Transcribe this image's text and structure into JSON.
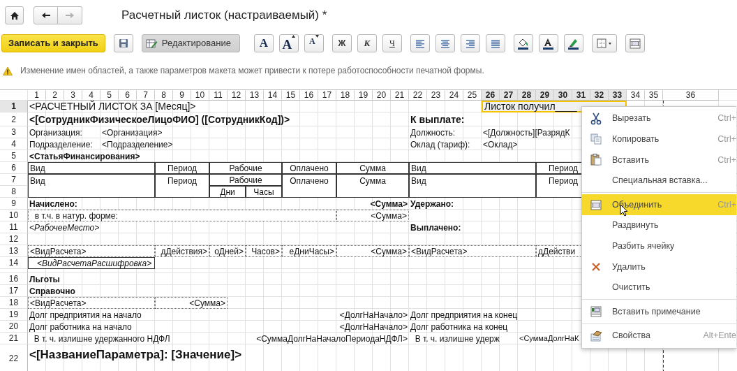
{
  "window": {
    "title": "Расчетный листок (настраиваемый) *",
    "nav": [
      {
        "kind": "home",
        "disabled": false
      },
      {
        "kind": "back",
        "disabled": false
      },
      {
        "kind": "forward",
        "disabled": true
      }
    ]
  },
  "toolbar": [
    {
      "kind": "primary",
      "label": "Записать и закрыть"
    },
    {
      "kind": "save"
    },
    {
      "kind": "toggle",
      "label": "Редактирование",
      "on": true
    },
    {
      "kind": "font",
      "label": "A"
    },
    {
      "kind": "grow",
      "label": "A"
    },
    {
      "kind": "shrink",
      "label": "A"
    },
    {
      "kind": "bold",
      "label": "Ж"
    },
    {
      "kind": "italic",
      "label": "К"
    },
    {
      "kind": "underline",
      "label": "Ч"
    },
    {
      "kind": "align-left"
    },
    {
      "kind": "align-center"
    },
    {
      "kind": "align-right"
    },
    {
      "kind": "justify"
    },
    {
      "kind": "fill-color"
    },
    {
      "kind": "text-color"
    },
    {
      "kind": "highlight"
    },
    {
      "kind": "borders"
    },
    {
      "kind": "cell"
    }
  ],
  "warning": "Изменение имен областей, а также параметров макета может привести к потере работоспособности печатной формы.",
  "sheet": {
    "column_numbers": [
      {
        "label": "1",
        "selected": false
      },
      {
        "label": "2",
        "selected": false
      },
      {
        "label": "3",
        "selected": false
      },
      {
        "label": "4",
        "selected": false
      },
      {
        "label": "5",
        "selected": false
      },
      {
        "label": "6",
        "selected": false
      },
      {
        "label": "7",
        "selected": false
      },
      {
        "label": "8",
        "selected": false
      },
      {
        "label": "9",
        "selected": false
      },
      {
        "label": "10",
        "selected": false
      },
      {
        "label": "11",
        "selected": false
      },
      {
        "label": "12",
        "selected": false
      },
      {
        "label": "13",
        "selected": false
      },
      {
        "label": "14",
        "selected": false
      },
      {
        "label": "15",
        "selected": false
      },
      {
        "label": "16",
        "selected": false
      },
      {
        "label": "17",
        "selected": false
      },
      {
        "label": "18",
        "selected": false
      },
      {
        "label": "19",
        "selected": false
      },
      {
        "label": "20",
        "selected": false
      },
      {
        "label": "21",
        "selected": false
      },
      {
        "label": "22",
        "selected": false
      },
      {
        "label": "23",
        "selected": false
      },
      {
        "label": "24",
        "selected": false
      },
      {
        "label": "25",
        "selected": false
      },
      {
        "label": "26",
        "selected": true
      },
      {
        "label": "27",
        "selected": true
      },
      {
        "label": "28",
        "selected": true
      },
      {
        "label": "29",
        "selected": true
      },
      {
        "label": "30",
        "selected": true
      },
      {
        "label": "31",
        "selected": true
      },
      {
        "label": "32",
        "selected": true
      },
      {
        "label": "33",
        "selected": true
      },
      {
        "label": "34",
        "selected": false
      },
      {
        "label": "35",
        "selected": false
      },
      {
        "label": "36",
        "selected": false
      }
    ],
    "lines": [
      {
        "number": "1",
        "kind": "title",
        "selected": true,
        "fields": [
          {
            "text": "<РАСЧЕТНЫЙ ЛИСТОК ЗА [Месяц]>"
          },
          {
            "text": "Листок получил____",
            "selected": true
          }
        ]
      },
      {
        "number": "2",
        "kind": "heading",
        "selected": false,
        "fields": [
          {
            "text": "<[СотрудникФизическоеЛицоФИО] ([СотрудникКод])>",
            "bold": true
          },
          {
            "text": "К выплате:",
            "bold": true
          }
        ]
      },
      {
        "number": "3",
        "kind": "normal",
        "selected": false,
        "fields": [
          {
            "text": "Организация:"
          },
          {
            "text": "<Организация>"
          },
          {
            "text": "Должность:"
          },
          {
            "text": "<[Должность][РазрядК"
          }
        ]
      },
      {
        "number": "4",
        "kind": "normal",
        "selected": false,
        "fields": [
          {
            "text": "Подразделение:"
          },
          {
            "text": "<Подразделение>"
          },
          {
            "text": "Оклад (тариф):"
          },
          {
            "text": "<Оклад>"
          }
        ]
      },
      {
        "number": "5",
        "kind": "normal",
        "selected": false,
        "fields": [
          {
            "text": "<СтатьяФинансирования>",
            "bold": true
          }
        ]
      },
      {
        "number": "6",
        "kind": "normal",
        "selected": false,
        "fields": [
          {
            "text": "Вид"
          },
          {
            "text": "Период"
          },
          {
            "text": "Рабочие"
          },
          {
            "text": "Оплачено"
          },
          {
            "text": "Сумма"
          },
          {
            "text": "Вид"
          },
          {
            "text": "Период"
          }
        ]
      },
      {
        "number": "7",
        "kind": "normal",
        "selected": false,
        "fields": [
          {
            "text": "Вид"
          },
          {
            "text": "Период"
          },
          {
            "text": "Рабочие"
          },
          {
            "text": "Оплачено"
          },
          {
            "text": "Сумма"
          },
          {
            "text": "Вид"
          },
          {
            "text": "Период"
          }
        ]
      },
      {
        "number": "8",
        "kind": "normal",
        "selected": false,
        "fields": [
          {
            "text": "Дни"
          },
          {
            "text": "Часы"
          }
        ]
      },
      {
        "number": "9",
        "kind": "normal",
        "selected": false,
        "fields": [
          {
            "text": "Начислено:",
            "bold": true
          },
          {
            "text": "<Сумма>",
            "bold": true
          },
          {
            "text": "Удержано:",
            "bold": true
          }
        ]
      },
      {
        "number": "10",
        "kind": "normal",
        "selected": false,
        "fields": [
          {
            "text": "  в т.ч. в натур. форме:"
          },
          {
            "text": "<Сумма>"
          }
        ]
      },
      {
        "number": "11",
        "kind": "normal",
        "selected": false,
        "fields": [
          {
            "text": "<РабочееМесто>",
            "italic": true
          },
          {
            "text": "Выплачено:",
            "bold": true
          }
        ]
      },
      {
        "number": "12",
        "kind": "normal",
        "selected": false
      },
      {
        "number": "13",
        "kind": "normal",
        "selected": false,
        "fields": [
          {
            "text": "<ВидРасчета>"
          },
          {
            "text": "дДействия>"
          },
          {
            "text": "оДней>"
          },
          {
            "text": "Часов>"
          },
          {
            "text": "еДниЧасы>"
          },
          {
            "text": "<Сумма>"
          },
          {
            "text": "<ВидРасчета>"
          },
          {
            "text": "дДействи"
          }
        ]
      },
      {
        "number": "14",
        "kind": "normal",
        "selected": false,
        "fields": [
          {
            "text": "   <ВидРасчетаРасшифровка>",
            "italic": true
          }
        ]
      },
      {
        "kind": "spacer",
        "selected": false
      },
      {
        "number": "16",
        "kind": "normal",
        "selected": false,
        "fields": [
          {
            "text": "Льготы",
            "bold": true
          }
        ]
      },
      {
        "number": "17",
        "kind": "normal",
        "selected": false,
        "fields": [
          {
            "text": "Справочно",
            "bold": true
          }
        ]
      },
      {
        "number": "18",
        "kind": "normal",
        "selected": false,
        "fields": [
          {
            "text": "<ВидРасчета>"
          },
          {
            "text": "<Сумма>"
          }
        ]
      },
      {
        "number": "19",
        "kind": "normal",
        "selected": false,
        "fields": [
          {
            "text": "Долг предприятия на начало"
          },
          {
            "text": "<ДолгНаНачало>"
          },
          {
            "text": "Долг предприятия на конец"
          }
        ]
      },
      {
        "number": "20",
        "kind": "normal",
        "selected": false,
        "fields": [
          {
            "text": "Долг работника на начало"
          },
          {
            "text": "<ДолгНаНачало>"
          },
          {
            "text": "Долг работника на конец"
          }
        ]
      },
      {
        "number": "21",
        "kind": "normal",
        "selected": false,
        "fields": [
          {
            "text": "  В т. ч. излишне удержанного НДФЛ"
          },
          {
            "text": "<СуммаДолгНаНачалоПериодаНДФЛ>"
          },
          {
            "text": "  В т. ч. излишне удерж"
          },
          {
            "text": "<СуммаДолгНаК"
          }
        ]
      },
      {
        "number": "22",
        "kind": "large",
        "selected": false,
        "fields": [
          {
            "text": "<[НазваниеПараметра]: [Значение]>",
            "bold": true
          }
        ]
      }
    ]
  },
  "context_menu": [
    {
      "kind": "cut",
      "label": "Вырезать",
      "shortcut": "Ctrl+",
      "selected": false
    },
    {
      "kind": "copy",
      "label": "Копировать",
      "shortcut": "Ctrl+",
      "selected": false
    },
    {
      "kind": "paste",
      "label": "Вставить",
      "shortcut": "Ctrl+",
      "selected": false
    },
    {
      "kind": "plain",
      "label": "Специальная вставка...",
      "selected": false
    },
    {
      "kind": "separator"
    },
    {
      "kind": "merge",
      "label": "Объединить",
      "shortcut": "Ctrl+",
      "selected": true
    },
    {
      "kind": "plain",
      "label": "Раздвинуть",
      "selected": false
    },
    {
      "kind": "plain",
      "label": "Разбить ячейку",
      "selected": false
    },
    {
      "kind": "delete",
      "label": "Удалить",
      "selected": false
    },
    {
      "kind": "plain",
      "label": "Очистить",
      "selected": false
    },
    {
      "kind": "separator"
    },
    {
      "kind": "note",
      "label": "Вставить примечание",
      "selected": false
    },
    {
      "kind": "separator"
    },
    {
      "kind": "properties",
      "label": "Свойства",
      "shortcut": "Alt+Ente",
      "selected": false
    }
  ]
}
